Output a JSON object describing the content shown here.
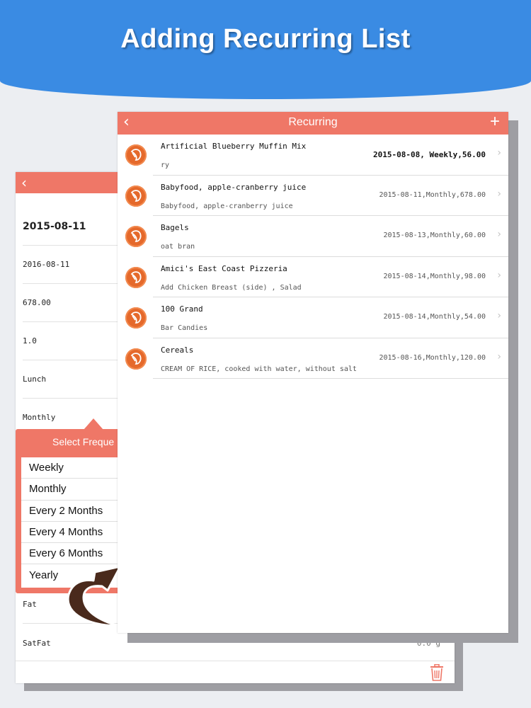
{
  "banner": {
    "title": "Adding Recurring List"
  },
  "back_panel": {
    "rows": [
      {
        "value": "2015-08-11",
        "big": true
      },
      {
        "value": "2016-08-11"
      },
      {
        "value": "678.00"
      },
      {
        "value": "1.0"
      },
      {
        "value": "Lunch"
      },
      {
        "value": "Monthly"
      }
    ],
    "bottom_rows": [
      {
        "label": "Fat",
        "value": ""
      },
      {
        "label": "SatFat",
        "value": "0.0 g"
      }
    ],
    "trash_icon": "trash-icon"
  },
  "popover": {
    "title": "Select Freque",
    "options": [
      "Weekly",
      "Monthly",
      "Every 2 Months",
      "Every 4 Months",
      "Every 6 Months",
      "Yearly"
    ]
  },
  "front_panel": {
    "title": "Recurring",
    "back_icon": "chevron-left-icon",
    "add_icon": "plus-icon",
    "items": [
      {
        "name": "Artificial Blueberry Muffin Mix",
        "sub": "ry",
        "detail": "2015-08-08, Weekly,56.00",
        "bold": true
      },
      {
        "name": "Babyfood, apple-cranberry juice",
        "sub": "Babyfood, apple-cranberry juice",
        "detail": "2015-08-11,Monthly,678.00"
      },
      {
        "name": "Bagels",
        "sub": "oat bran",
        "detail": "2015-08-13,Monthly,60.00"
      },
      {
        "name": "Amici's East Coast Pizzeria",
        "sub": "Add Chicken Breast (side) , Salad",
        "detail": "2015-08-14,Monthly,98.00"
      },
      {
        "name": "100 Grand",
        "sub": "Bar Candies",
        "detail": "2015-08-14,Monthly,54.00"
      },
      {
        "name": "Cereals",
        "sub": "CREAM OF RICE, cooked with water, without salt",
        "detail": "2015-08-16,Monthly,120.00"
      }
    ]
  },
  "colors": {
    "banner": "#3a8be3",
    "accent": "#ef7767",
    "icon": "#e5692b",
    "arrow": "#4a2a1c"
  }
}
